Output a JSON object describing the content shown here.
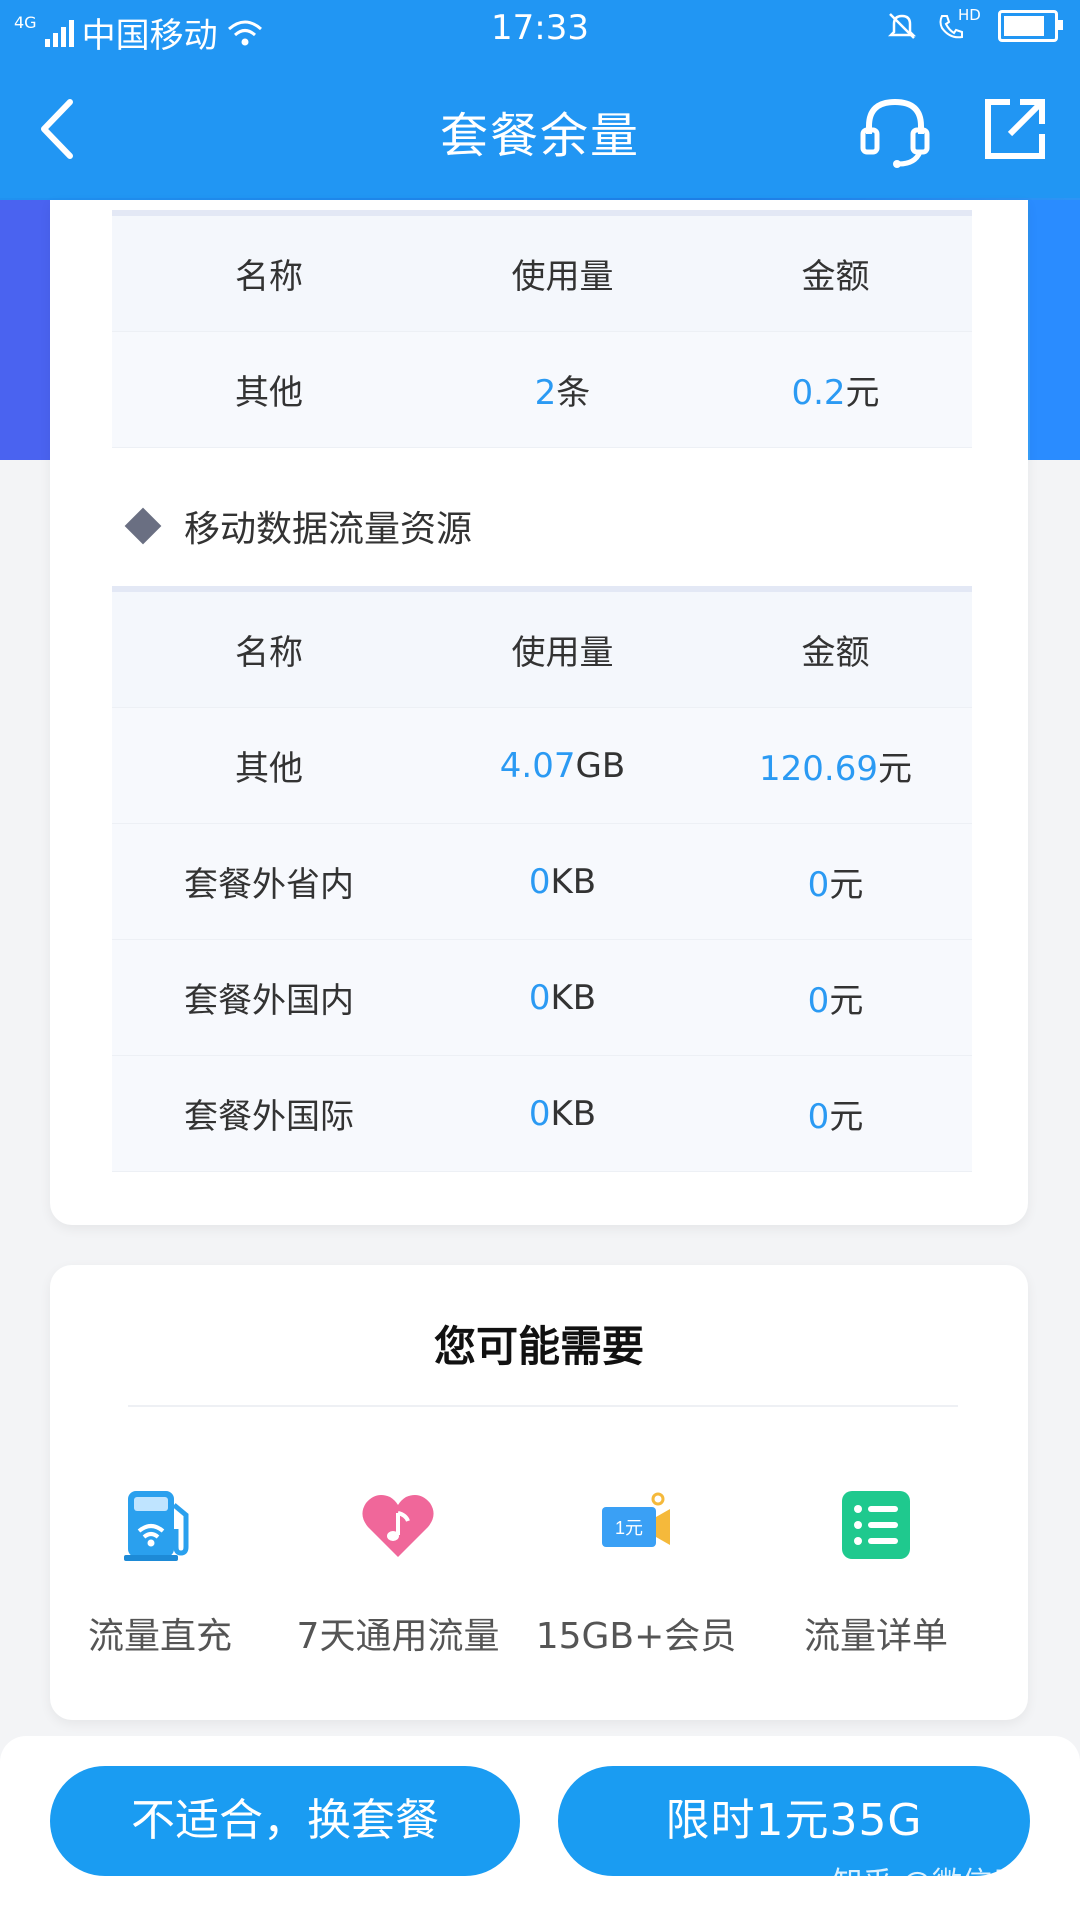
{
  "status_bar": {
    "network": "4G",
    "carrier": "中国移动",
    "time": "17:33",
    "hd": "HD"
  },
  "nav": {
    "title": "套餐余量"
  },
  "sms_table": {
    "headers": [
      "名称",
      "使用量",
      "金额"
    ],
    "rows": [
      {
        "name": "其他",
        "usage_value": "2",
        "usage_unit": "条",
        "amount_value": "0.2",
        "amount_unit": "元"
      }
    ]
  },
  "data_section": {
    "title": "移动数据流量资源"
  },
  "data_table": {
    "headers": [
      "名称",
      "使用量",
      "金额"
    ],
    "rows": [
      {
        "name": "其他",
        "usage_value": "4.07",
        "usage_unit": "GB",
        "amount_value": "120.69",
        "amount_unit": "元"
      },
      {
        "name": "套餐外省内",
        "usage_value": "0",
        "usage_unit": "KB",
        "amount_value": "0",
        "amount_unit": "元"
      },
      {
        "name": "套餐外国内",
        "usage_value": "0",
        "usage_unit": "KB",
        "amount_value": "0",
        "amount_unit": "元"
      },
      {
        "name": "套餐外国际",
        "usage_value": "0",
        "usage_unit": "KB",
        "amount_value": "0",
        "amount_unit": "元"
      }
    ]
  },
  "recommend": {
    "title": "您可能需要",
    "items": [
      {
        "label": "流量直充",
        "icon": "fuel-pump-wifi-icon",
        "color": "#2aa0ee"
      },
      {
        "label": "7天通用流量",
        "icon": "heart-icon",
        "color": "#f0679a"
      },
      {
        "label": "15GB+会员",
        "icon": "ticket-icon",
        "color": "#3aa0f5",
        "icon_text": "1元"
      },
      {
        "label": "流量详单",
        "icon": "list-icon",
        "color": "#1fc98e"
      }
    ]
  },
  "bottom": {
    "left_button": "不适合，换套餐",
    "right_button": "限时1元35G"
  },
  "watermark": "知乎 @微信用户",
  "colors": {
    "primary": "#2196f3",
    "button": "#1a9cf2",
    "value": "#2b9af3"
  }
}
